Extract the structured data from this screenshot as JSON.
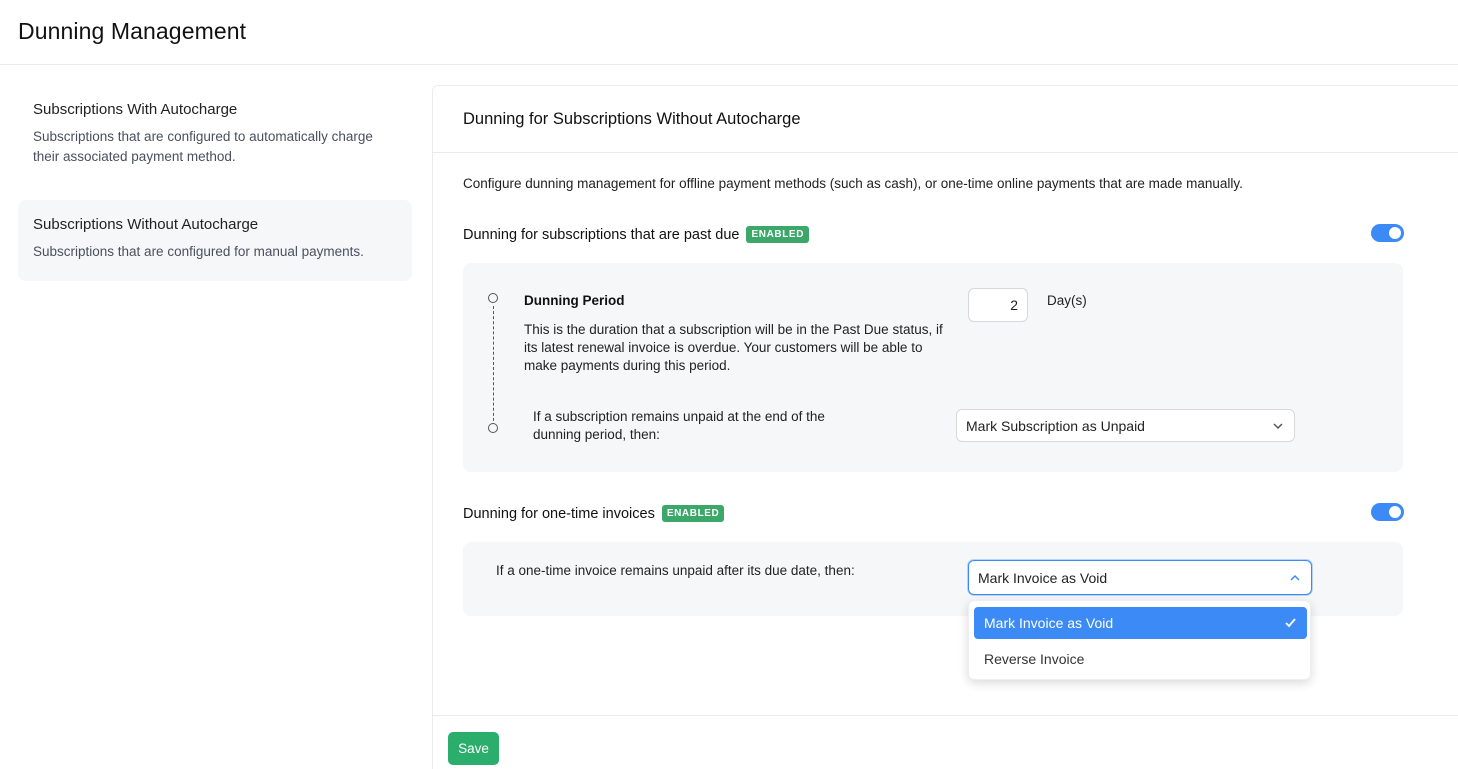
{
  "page": {
    "title": "Dunning Management"
  },
  "sidebar": {
    "items": [
      {
        "title": "Subscriptions With Autocharge",
        "description": "Subscriptions that are configured to automatically charge their associated payment method."
      },
      {
        "title": "Subscriptions Without Autocharge",
        "description": "Subscriptions that are configured for manual payments."
      }
    ]
  },
  "main": {
    "title": "Dunning for Subscriptions Without Autocharge",
    "intro": "Configure dunning management for offline payment methods (such as cash), or one-time online payments that are made manually.",
    "past_due": {
      "heading": "Dunning for subscriptions that are past due",
      "badge": "ENABLED",
      "enabled": true,
      "period_title": "Dunning Period",
      "period_description": "This is the duration that a subscription will be in the Past Due status, if its latest renewal invoice is overdue. Your customers will be able to make payments during this period.",
      "days_value": "2",
      "days_unit": "Day(s)",
      "unpaid_label": "If a subscription remains unpaid at the end of the dunning period, then:",
      "unpaid_action": "Mark Subscription as Unpaid"
    },
    "one_time": {
      "heading": "Dunning for one-time invoices",
      "badge": "ENABLED",
      "enabled": true,
      "label": "If a one-time invoice remains unpaid after its due date, then:",
      "selected": "Mark Invoice as Void",
      "options": [
        "Mark Invoice as Void",
        "Reverse Invoice"
      ]
    }
  },
  "footer": {
    "save_label": "Save"
  },
  "colors": {
    "accent": "#3b8af5",
    "success": "#2bad6b",
    "badge": "#3ba86a"
  }
}
